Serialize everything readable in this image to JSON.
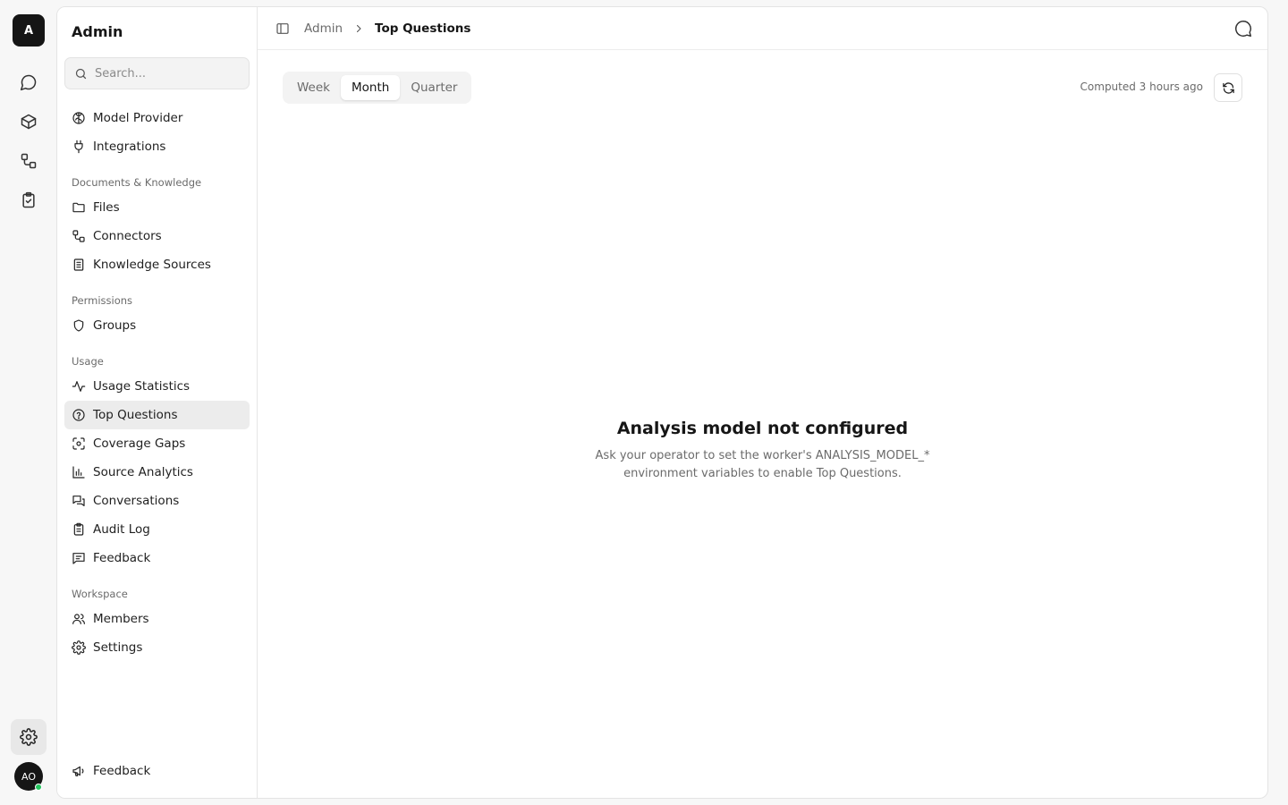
{
  "rail": {
    "logo_letter": "A",
    "items": [
      {
        "icon": "chat-bubble-icon"
      },
      {
        "icon": "cube-icon"
      },
      {
        "icon": "connectors-icon"
      },
      {
        "icon": "clipboard-check-icon"
      }
    ],
    "settings_icon": "gear-icon",
    "avatar_initials": "AO",
    "status_color": "#22c55e"
  },
  "sidebar": {
    "title": "Admin",
    "search_placeholder": "Search...",
    "top_items": [
      {
        "label": "Model Provider",
        "icon": "brain-icon"
      },
      {
        "label": "Integrations",
        "icon": "plug-icon"
      }
    ],
    "sections": [
      {
        "label": "Documents & Knowledge",
        "items": [
          {
            "label": "Files",
            "icon": "folder-icon"
          },
          {
            "label": "Connectors",
            "icon": "connectors-icon"
          },
          {
            "label": "Knowledge Sources",
            "icon": "document-icon"
          }
        ]
      },
      {
        "label": "Permissions",
        "items": [
          {
            "label": "Groups",
            "icon": "shield-icon"
          }
        ]
      },
      {
        "label": "Usage",
        "items": [
          {
            "label": "Usage Statistics",
            "icon": "activity-icon"
          },
          {
            "label": "Top Questions",
            "icon": "question-circle-icon",
            "active": true
          },
          {
            "label": "Coverage Gaps",
            "icon": "scan-icon"
          },
          {
            "label": "Source Analytics",
            "icon": "bar-chart-icon"
          },
          {
            "label": "Conversations",
            "icon": "conversations-icon"
          },
          {
            "label": "Audit Log",
            "icon": "clipboard-list-icon"
          },
          {
            "label": "Feedback",
            "icon": "message-square-text-icon"
          }
        ]
      },
      {
        "label": "Workspace",
        "items": [
          {
            "label": "Members",
            "icon": "users-icon"
          },
          {
            "label": "Settings",
            "icon": "gear-icon"
          }
        ]
      }
    ],
    "bottom_item": {
      "label": "Feedback",
      "icon": "megaphone-icon"
    }
  },
  "header": {
    "breadcrumb_parent": "Admin",
    "breadcrumb_current": "Top Questions"
  },
  "toolbar": {
    "tabs": [
      {
        "label": "Week"
      },
      {
        "label": "Month",
        "active": true
      },
      {
        "label": "Quarter"
      }
    ],
    "computed_text": "Computed 3 hours ago"
  },
  "empty_state": {
    "title": "Analysis model not configured",
    "description": "Ask your operator to set the worker's ANALYSIS_MODEL_* environment variables to enable Top Questions."
  }
}
